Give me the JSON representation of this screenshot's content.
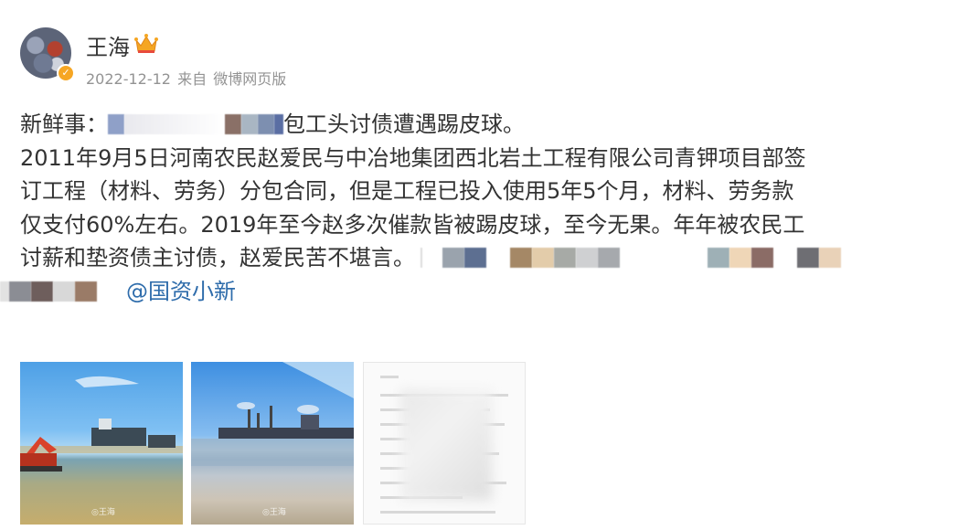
{
  "user": {
    "name": "王海",
    "crown_icon": "crown-icon",
    "verified_icon": "verified-badge-icon"
  },
  "meta": {
    "date": "2022-12-12",
    "source_prefix": "来自",
    "source": "微博网页版"
  },
  "post": {
    "line1_prefix": "新鲜事：",
    "line1_suffix": "包工头讨债遭遇踢皮球。",
    "line2": "2011年9月5日河南农民赵爱民与中冶地集团西北岩土工程有限公司青钾项目部签",
    "line3": "订工程（材料、劳务）分包合同，但是工程已投入使用5年5个月，材料、劳务款",
    "line4": "仅支付60%左右。2019年至今赵多次催款皆被踢皮球，至今无果。年年被农民工",
    "line5": "讨薪和垫资债主讨债，赵爱民苦不堪言。",
    "mention": "@国资小新"
  },
  "photos": [
    {
      "name": "photo-excavator-lake",
      "watermark": "◎王海"
    },
    {
      "name": "photo-lake-factory",
      "watermark": "◎王海"
    },
    {
      "name": "photo-contract-document"
    }
  ],
  "colors": {
    "mention": "#2e6cab",
    "meta": "#939393",
    "text": "#333333"
  }
}
